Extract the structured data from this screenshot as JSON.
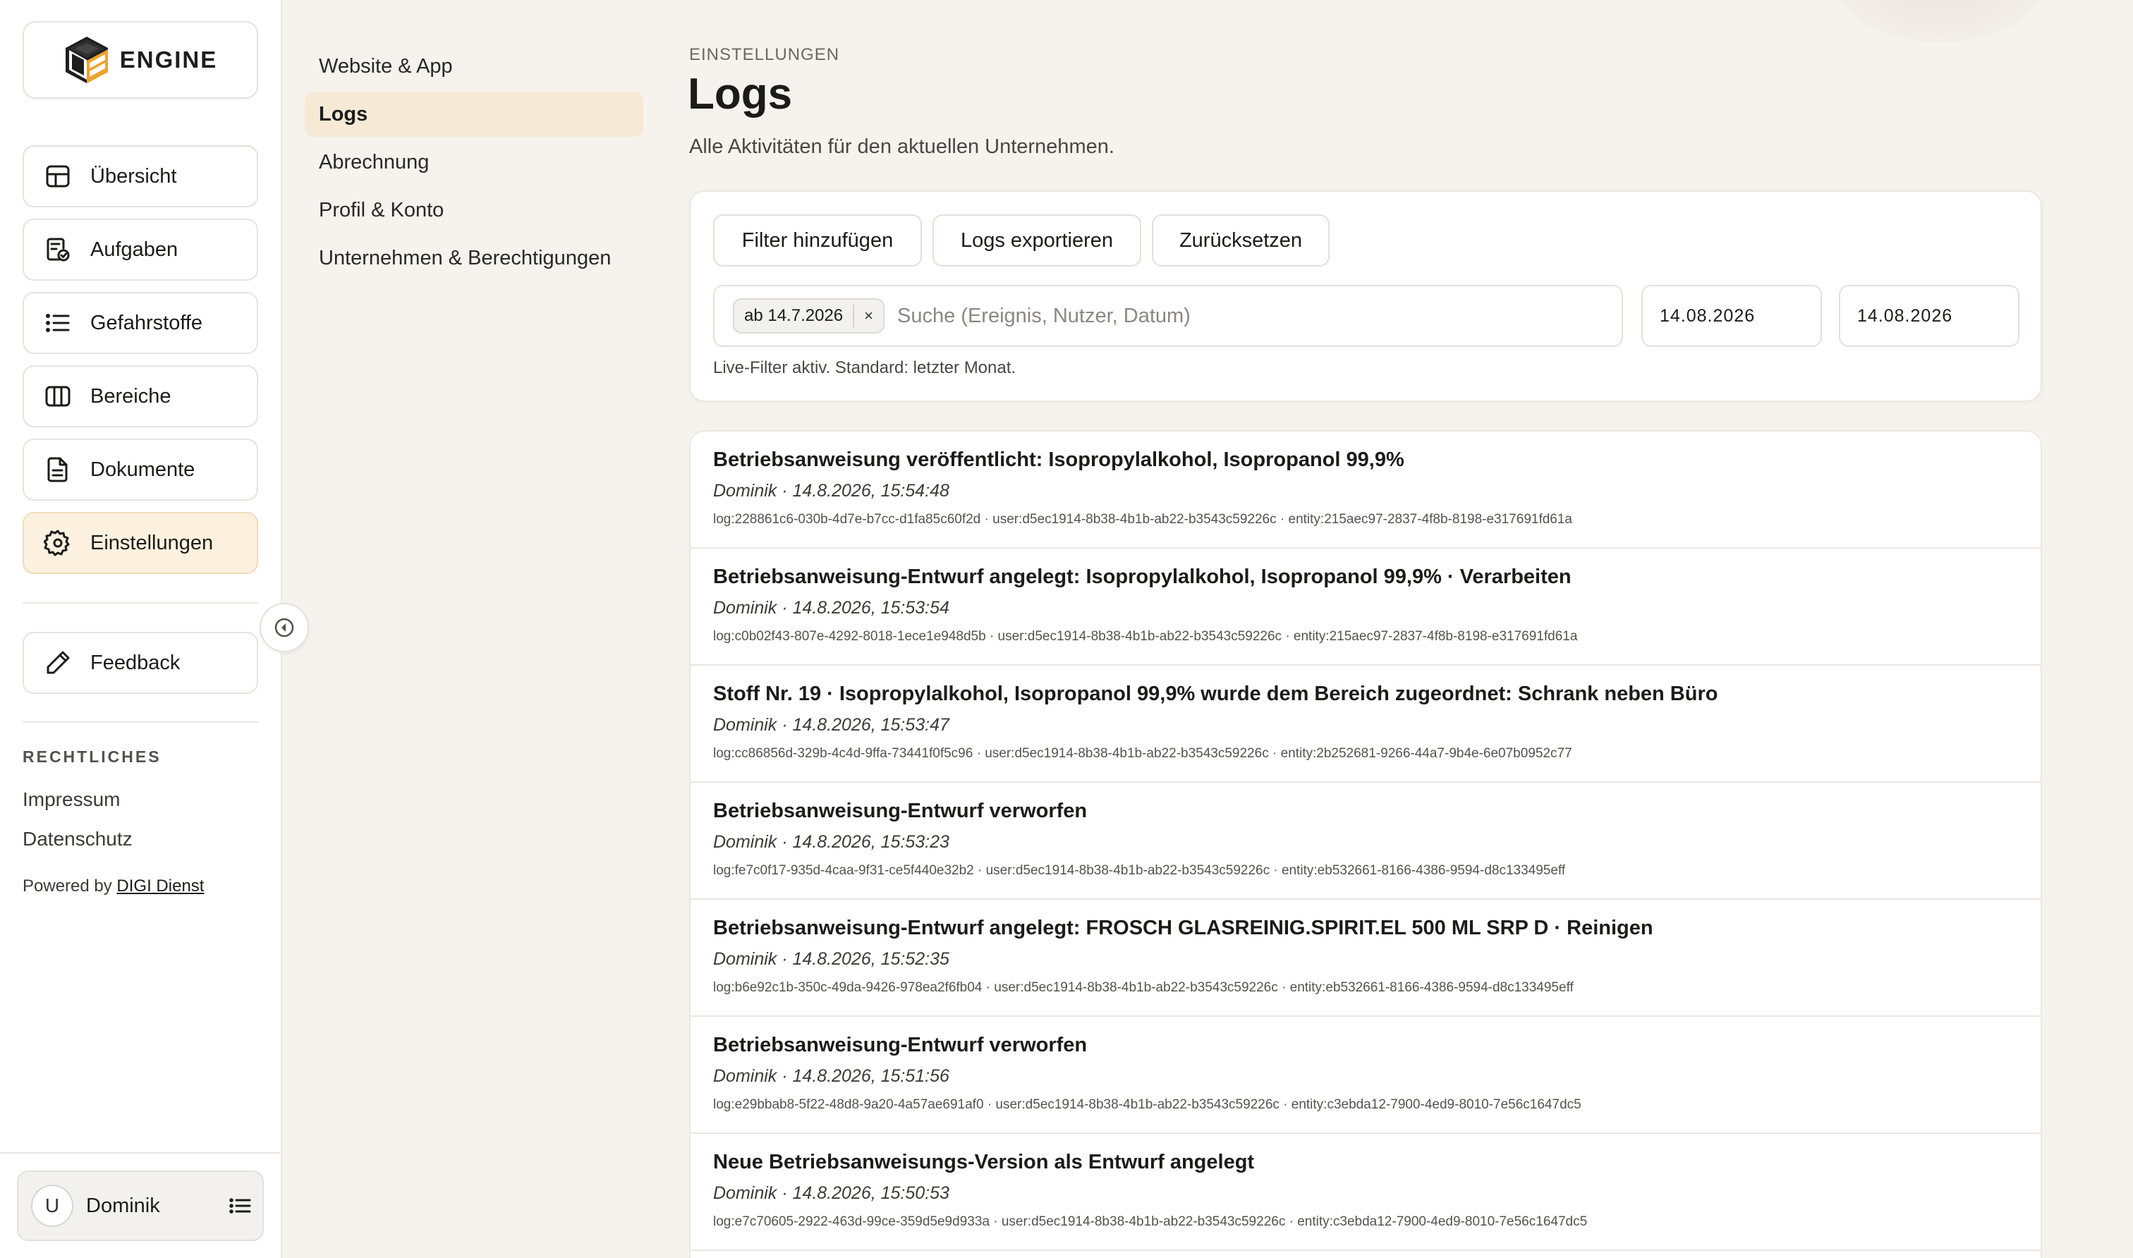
{
  "brand": {
    "name": "ENGINE"
  },
  "sidebar": {
    "items": [
      {
        "label": "Übersicht",
        "icon": "layout-icon",
        "active": false
      },
      {
        "label": "Aufgaben",
        "icon": "task-check-icon",
        "active": false
      },
      {
        "label": "Gefahrstoffe",
        "icon": "list-icon",
        "active": false
      },
      {
        "label": "Bereiche",
        "icon": "columns-icon",
        "active": false
      },
      {
        "label": "Dokumente",
        "icon": "document-icon",
        "active": false
      },
      {
        "label": "Einstellungen",
        "icon": "gear-icon",
        "active": true
      }
    ],
    "feedback_label": "Feedback",
    "legal_heading": "RECHTLICHES",
    "legal_links": [
      "Impressum",
      "Datenschutz"
    ],
    "powered_prefix": "Powered by",
    "powered_link": "DIGI Dienst",
    "user": {
      "initial": "U",
      "name": "Dominik"
    }
  },
  "settings_nav": {
    "items": [
      {
        "label": "Website & App",
        "active": false
      },
      {
        "label": "Logs",
        "active": true
      },
      {
        "label": "Abrechnung",
        "active": false
      },
      {
        "label": "Profil & Konto",
        "active": false
      },
      {
        "label": "Unternehmen & Berechtigungen",
        "active": false
      }
    ]
  },
  "header": {
    "eyebrow": "EINSTELLUNGEN",
    "title": "Logs",
    "subtitle": "Alle Aktivitäten für den aktuellen Unternehmen."
  },
  "filters": {
    "buttons": [
      "Filter hinzufügen",
      "Logs exportieren",
      "Zurücksetzen"
    ],
    "chip_label": "ab 14.7.2026",
    "chip_remove": "×",
    "search_placeholder": "Suche (Ereignis, Nutzer, Datum)",
    "date_from": "14.08.2026",
    "date_to": "14.08.2026",
    "hint": "Live-Filter aktiv. Standard: letzter Monat."
  },
  "logs": [
    {
      "title": "Betriebsanweisung veröffentlicht: Isopropylalkohol, Isopropanol 99,9%",
      "meta": "Dominik · 14.8.2026, 15:54:48",
      "ids": "log:228861c6-030b-4d7e-b7cc-d1fa85c60f2d · user:d5ec1914-8b38-4b1b-ab22-b3543c59226c · entity:215aec97-2837-4f8b-8198-e317691fd61a"
    },
    {
      "title": "Betriebsanweisung-Entwurf angelegt: Isopropylalkohol, Isopropanol 99,9% · Verarbeiten",
      "meta": "Dominik · 14.8.2026, 15:53:54",
      "ids": "log:c0b02f43-807e-4292-8018-1ece1e948d5b · user:d5ec1914-8b38-4b1b-ab22-b3543c59226c · entity:215aec97-2837-4f8b-8198-e317691fd61a"
    },
    {
      "title": "Stoff Nr. 19 · Isopropylalkohol, Isopropanol 99,9% wurde dem Bereich zugeordnet: Schrank neben Büro",
      "meta": "Dominik · 14.8.2026, 15:53:47",
      "ids": "log:cc86856d-329b-4c4d-9ffa-73441f0f5c96 · user:d5ec1914-8b38-4b1b-ab22-b3543c59226c · entity:2b252681-9266-44a7-9b4e-6e07b0952c77"
    },
    {
      "title": "Betriebsanweisung-Entwurf verworfen",
      "meta": "Dominik · 14.8.2026, 15:53:23",
      "ids": "log:fe7c0f17-935d-4caa-9f31-ce5f440e32b2 · user:d5ec1914-8b38-4b1b-ab22-b3543c59226c · entity:eb532661-8166-4386-9594-d8c133495eff"
    },
    {
      "title": "Betriebsanweisung-Entwurf angelegt: FROSCH GLASREINIG.SPIRIT.EL 500 ML SRP D · Reinigen",
      "meta": "Dominik · 14.8.2026, 15:52:35",
      "ids": "log:b6e92c1b-350c-49da-9426-978ea2f6fb04 · user:d5ec1914-8b38-4b1b-ab22-b3543c59226c · entity:eb532661-8166-4386-9594-d8c133495eff"
    },
    {
      "title": "Betriebsanweisung-Entwurf verworfen",
      "meta": "Dominik · 14.8.2026, 15:51:56",
      "ids": "log:e29bbab8-5f22-48d8-9a20-4a57ae691af0 · user:d5ec1914-8b38-4b1b-ab22-b3543c59226c · entity:c3ebda12-7900-4ed9-8010-7e56c1647dc5"
    },
    {
      "title": "Neue Betriebsanweisungs-Version als Entwurf angelegt",
      "meta": "Dominik · 14.8.2026, 15:50:53",
      "ids": "log:e7c70605-2922-463d-99ce-359d5e9d933a · user:d5ec1914-8b38-4b1b-ab22-b3543c59226c · entity:c3ebda12-7900-4ed9-8010-7e56c1647dc5"
    }
  ],
  "colors": {
    "accent_bg": "#fdf1df",
    "subnav_active_bg": "#f6e9d6",
    "logo_orange": "#f2a227",
    "page_bg": "#f6f3ee"
  }
}
